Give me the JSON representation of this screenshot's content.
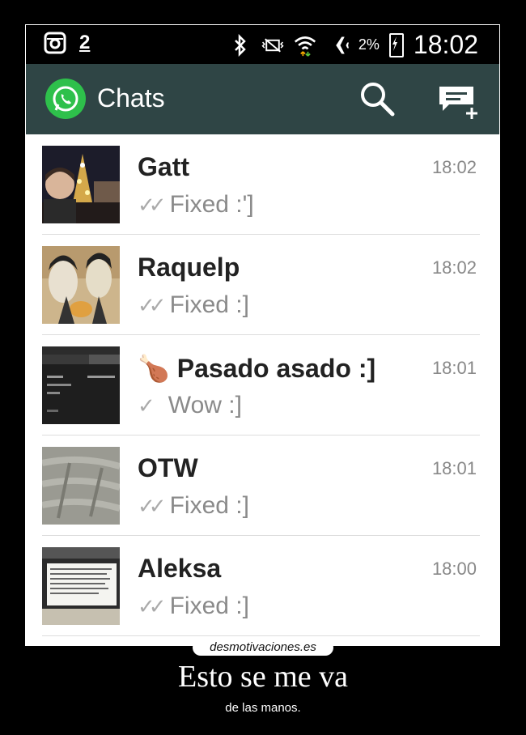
{
  "statusbar": {
    "left_icons": [
      "instagram-icon",
      "usb-download-icon"
    ],
    "notification_count": "2",
    "right_icons": [
      "bluetooth-icon",
      "muted-vibrate-icon",
      "wifi-icon",
      "airplane-icon",
      "battery-charging-icon"
    ],
    "battery_percent": "2%",
    "clock": "18:02"
  },
  "actionbar": {
    "title": "Chats",
    "actions": [
      "search-icon",
      "new-chat-icon"
    ],
    "color": "#2f4545",
    "logo_color": "#2ec04b"
  },
  "chats": [
    {
      "name": "Gatt",
      "time": "18:02",
      "status": "double-tick",
      "message": "Fixed :']"
    },
    {
      "name": "Raquelp",
      "time": "18:02",
      "status": "double-tick",
      "message": "Fixed :]"
    },
    {
      "name": "Pasado asado :]",
      "emoji": "🍗",
      "time": "18:01",
      "status": "single-tick",
      "message": "Wow :]"
    },
    {
      "name": "OTW",
      "time": "18:01",
      "status": "double-tick",
      "message": "Fixed :]"
    },
    {
      "name": "Aleksa",
      "time": "18:00",
      "status": "double-tick",
      "message": "Fixed :]"
    }
  ],
  "footer": {
    "brand": "desmotivaciones.es",
    "title": "Esto se me va",
    "subtitle": "de las manos."
  }
}
